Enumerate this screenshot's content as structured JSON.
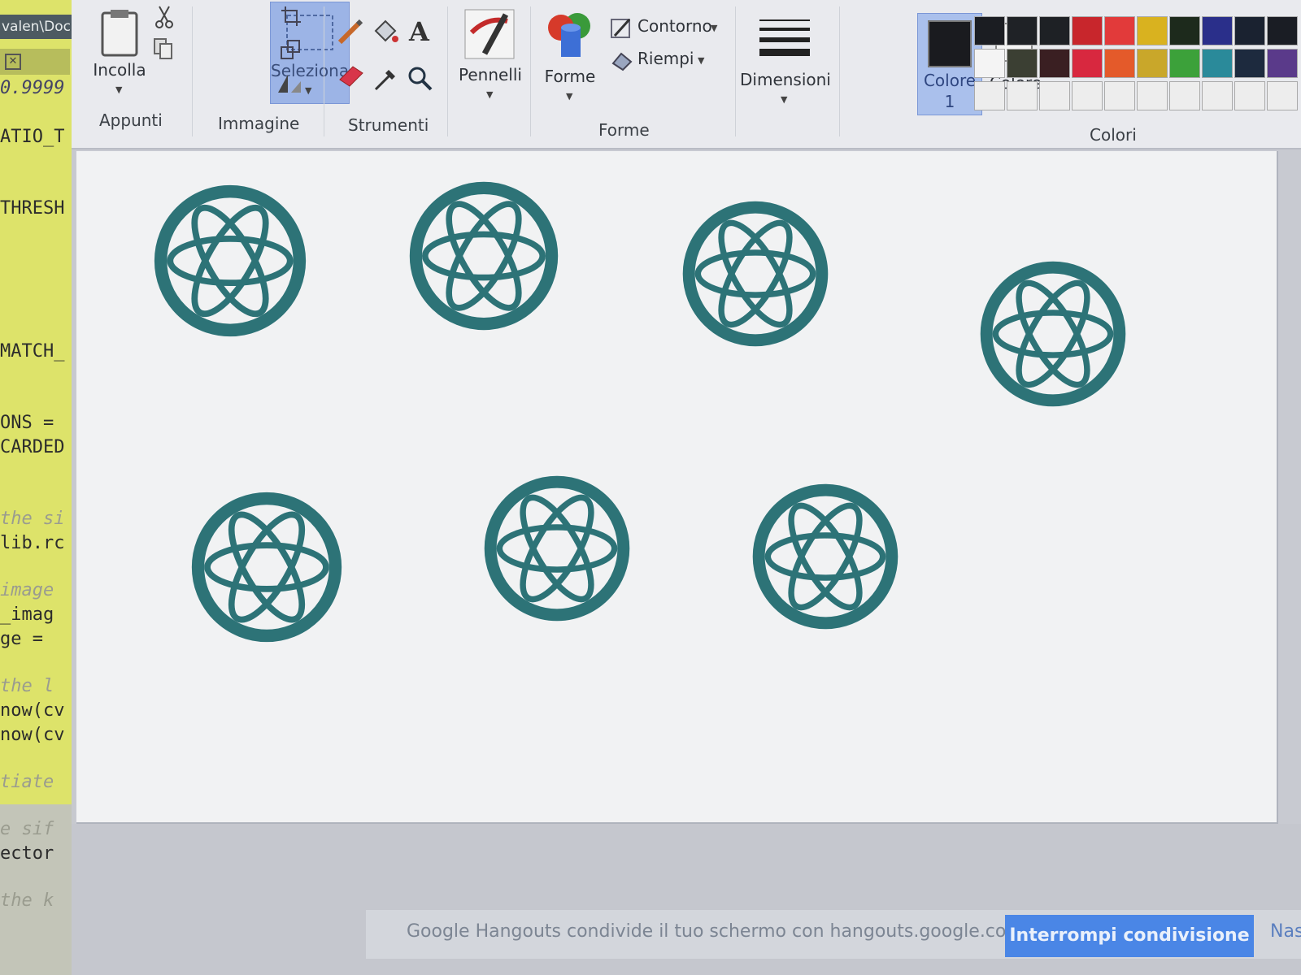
{
  "editor": {
    "path_text": "valen\\Doc",
    "tab_close": "✕",
    "lines": [
      "0.9999",
      "ATIO_T",
      "THRESH",
      "MATCH_",
      "ONS =",
      "CARDED",
      "the si",
      "lib.rc",
      "image",
      "_imag",
      "ge =",
      "the l",
      "now(cv",
      "now(cv",
      "tiate",
      "e sif",
      "ector",
      "the k"
    ]
  },
  "ribbon": {
    "groups": {
      "clipboard": "Appunti",
      "image": "Immagine",
      "tools": "Strumenti",
      "shapes": "Forme",
      "colors": "Colori"
    },
    "paste_label": "Incolla",
    "select_label": "Seleziona",
    "brushes_label": "Pennelli",
    "shapes_label": "Forme",
    "outline_label": "Contorno",
    "fill_label": "Riempi",
    "size_label": "Dimensioni",
    "color1_label": "Colore",
    "color1_num": "1",
    "color2_label": "Colore",
    "color2_num": "2",
    "palette_row1": [
      "#1b1d22",
      "#1f2226",
      "#1e2125",
      "#c8262c",
      "#e23a3a",
      "#d9b21f",
      "#1d2a1c",
      "#2a2f8a",
      "#1a2230",
      "#1a1d24"
    ],
    "palette_row2": [
      "#f4f4f4",
      "#3b3f33",
      "#3a1f22",
      "#d8283f",
      "#e45a2a",
      "#c9a72a",
      "#3ca13a",
      "#2a8a9a",
      "#1d2a3e",
      "#5a3a8a"
    ],
    "palette_row3": [
      "#ededed",
      "#ededed",
      "#ededed",
      "#ededed",
      "#ededed",
      "#ededed",
      "#ededed",
      "#ededed",
      "#ededed",
      "#ededed"
    ]
  },
  "canvas": {
    "atom_color": "#2d7377",
    "atom_count": 7
  },
  "share": {
    "message": "Google Hangouts condivide il tuo schermo con hangouts.google.com.",
    "stop_label": "Interrompi condivisione",
    "hide_label": "Nasc"
  }
}
